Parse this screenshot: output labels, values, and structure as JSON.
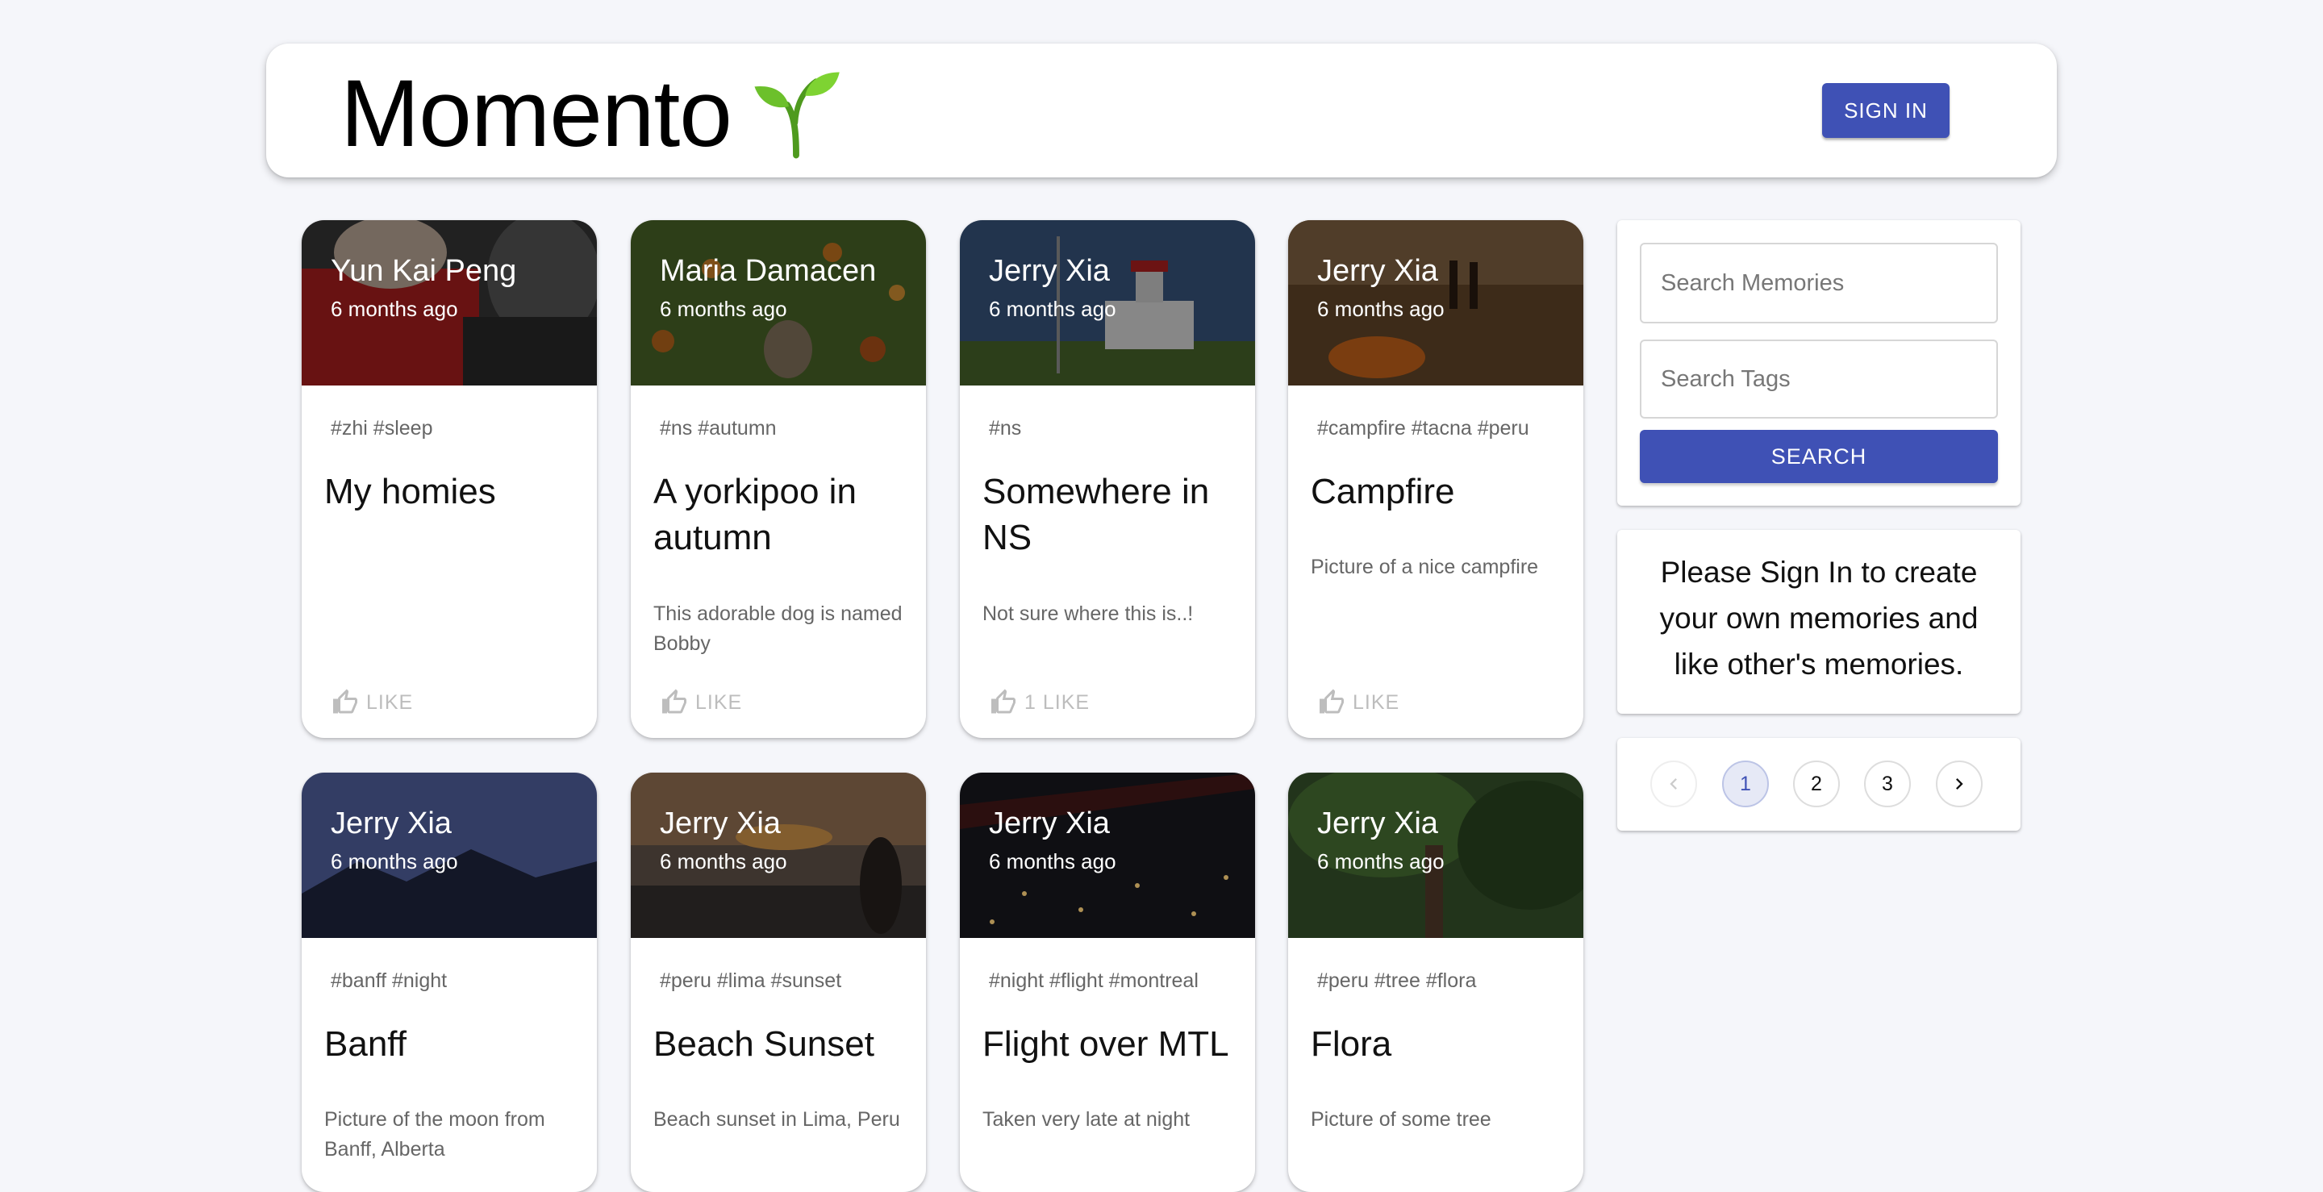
{
  "header": {
    "brand": "Momento",
    "sign_in_label": "SIGN IN"
  },
  "posts": [
    {
      "creator": "Yun Kai Peng",
      "created": "6 months ago",
      "tags": "#zhi #sleep",
      "title": "My homies",
      "message": "",
      "likes": "LIKE"
    },
    {
      "creator": "Maria Damacen",
      "created": "6 months ago",
      "tags": "#ns #autumn",
      "title": "A yorkipoo in autumn",
      "message": "This adorable dog is named Bobby",
      "likes": "LIKE"
    },
    {
      "creator": "Jerry Xia",
      "created": "6 months ago",
      "tags": "#ns",
      "title": "Somewhere in NS",
      "message": "Not sure where this is..!",
      "likes": "1 LIKE"
    },
    {
      "creator": "Jerry Xia",
      "created": "6 months ago",
      "tags": "#campfire #tacna #peru",
      "title": "Campfire",
      "message": "Picture of a nice campfire",
      "likes": "LIKE"
    },
    {
      "creator": "Jerry Xia",
      "created": "6 months ago",
      "tags": "#banff #night",
      "title": "Banff",
      "message": "Picture of the moon from Banff, Alberta",
      "likes": ""
    },
    {
      "creator": "Jerry Xia",
      "created": "6 months ago",
      "tags": "#peru #lima #sunset",
      "title": "Beach Sunset",
      "message": "Beach sunset in Lima, Peru",
      "likes": ""
    },
    {
      "creator": "Jerry Xia",
      "created": "6 months ago",
      "tags": "#night #flight #montreal",
      "title": "Flight over MTL",
      "message": "Taken very late at night",
      "likes": ""
    },
    {
      "creator": "Jerry Xia",
      "created": "6 months ago",
      "tags": "#peru #tree #flora",
      "title": "Flora",
      "message": "Picture of some tree",
      "likes": ""
    }
  ],
  "search": {
    "memories_placeholder": "Search Memories",
    "tags_placeholder": "Search Tags",
    "button_label": "SEARCH"
  },
  "signin_note": "Please Sign In to create your own memories and like other's memories.",
  "pagination": {
    "pages": [
      "1",
      "2",
      "3"
    ],
    "current": "1"
  },
  "colors": {
    "primary": "#3f51b5",
    "background": "#f5f6fa"
  },
  "icons": {
    "brand": "sprout-icon",
    "like": "thumb-up-outline-icon",
    "prev": "chevron-left-icon",
    "next": "chevron-right-icon"
  }
}
